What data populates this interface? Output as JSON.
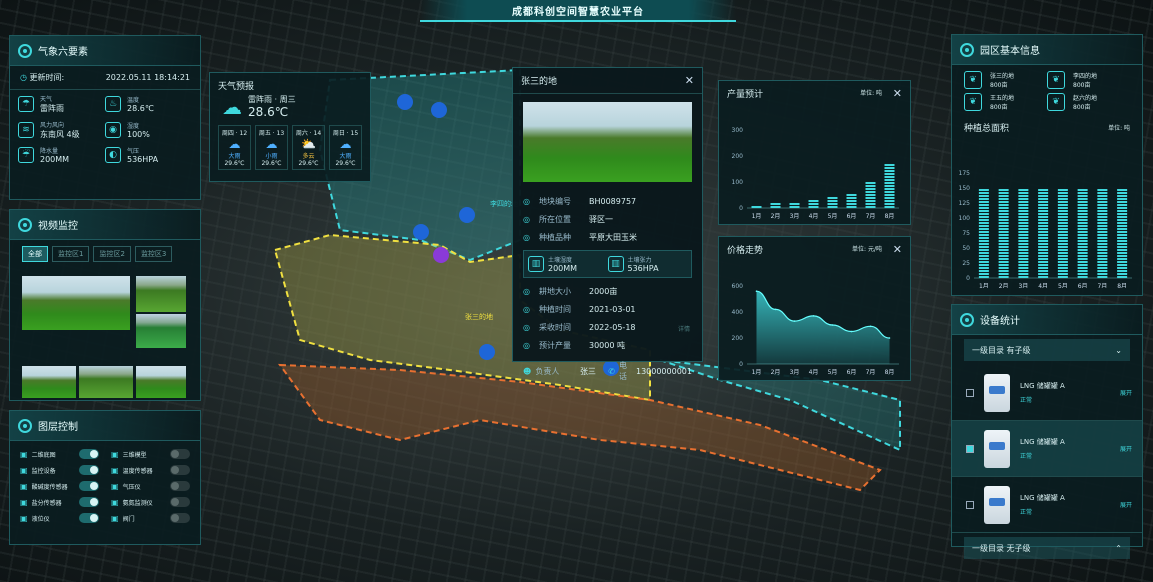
{
  "header": {
    "title": "成都科创空间智慧农业平台"
  },
  "weather": {
    "title": "气象六要素",
    "update_label": "更新时间:",
    "update_time": "2022.05.11 18:14:21",
    "items": [
      {
        "icon": "cloud-rain-icon",
        "label": "天气",
        "value": "雷阵雨"
      },
      {
        "icon": "thermometer-icon",
        "label": "温度",
        "value": "28.6℃"
      },
      {
        "icon": "wind-icon",
        "label": "风力风向",
        "value": "东南风 4级"
      },
      {
        "icon": "droplet-icon",
        "label": "湿度",
        "value": "100%"
      },
      {
        "icon": "rain-gauge-icon",
        "label": "降水量",
        "value": "200MM"
      },
      {
        "icon": "pressure-icon",
        "label": "气压",
        "value": "536HPA"
      }
    ]
  },
  "forecast": {
    "title": "天气预报",
    "now_desc": "雷阵雨 · 周三",
    "now_temp": "28.6℃",
    "days": [
      {
        "day": "周四 · 12",
        "desc": "大雨",
        "temp": "29.6℃",
        "color": "#4fb0ff"
      },
      {
        "day": "周五 · 13",
        "desc": "小雨",
        "temp": "29.6℃",
        "color": "#4fb0ff"
      },
      {
        "day": "周六 · 14",
        "desc": "多云",
        "temp": "29.6℃",
        "color": "#f0c040"
      },
      {
        "day": "周日 · 15",
        "desc": "大雨",
        "temp": "29.6℃",
        "color": "#4fb0ff"
      }
    ]
  },
  "video": {
    "title": "视频监控",
    "tabs": [
      "全部",
      "监控区1",
      "监控区2",
      "监控区3"
    ]
  },
  "layers": {
    "title": "图层控制",
    "items": [
      {
        "label": "二维底图",
        "on": true
      },
      {
        "label": "三维模型",
        "on": false
      },
      {
        "label": "监控设备",
        "on": true
      },
      {
        "label": "温度传感器",
        "on": false
      },
      {
        "label": "酸碱度传感器",
        "on": true
      },
      {
        "label": "气压仪",
        "on": false
      },
      {
        "label": "盐分传感器",
        "on": true
      },
      {
        "label": "氨氮监测仪",
        "on": false
      },
      {
        "label": "液位仪",
        "on": true
      },
      {
        "label": "阀门",
        "on": false
      }
    ]
  },
  "plot": {
    "title": "张三的地",
    "fields": [
      {
        "icon": "id-icon",
        "label": "地块编号",
        "value": "BH0089757"
      },
      {
        "icon": "location-pin-icon",
        "label": "所在位置",
        "value": "驿区一"
      },
      {
        "icon": "sprout-icon",
        "label": "种植品种",
        "value": "平原大田玉米"
      }
    ],
    "soil": [
      {
        "label": "土壤湿度",
        "value": "200MM"
      },
      {
        "label": "土壤张力",
        "value": "536HPA"
      }
    ],
    "fields2": [
      {
        "icon": "area-icon",
        "label": "耕地大小",
        "value": "2000亩"
      },
      {
        "icon": "clock-icon",
        "label": "种植时间",
        "value": "2021-03-01"
      },
      {
        "icon": "harvest-icon",
        "label": "采收时间",
        "value": "2022-05-18"
      },
      {
        "icon": "chart-icon",
        "label": "预计产量",
        "value": "30000 吨"
      }
    ],
    "detail_link": "详情",
    "owner_label": "负责人",
    "owner": "张三",
    "phone_label": "电话",
    "phone": "13000000001"
  },
  "map_labels": {
    "plot_a": "张三的地",
    "plot_b": "李四的地"
  },
  "yield": {
    "title": "产量预计",
    "unit": "单位: 吨"
  },
  "price": {
    "title": "价格走势",
    "unit": "单位: 元/吨"
  },
  "park": {
    "title": "园区基本信息",
    "items": [
      {
        "name": "张三的地",
        "area": "800亩"
      },
      {
        "name": "李四的地",
        "area": "800亩"
      },
      {
        "name": "王五的地",
        "area": "800亩"
      },
      {
        "name": "赵六的地",
        "area": "800亩"
      }
    ],
    "area_title": "种植总面积",
    "area_unit": "单位: 吨"
  },
  "devices": {
    "title": "设备统计",
    "group_top": "一级目录 有子级",
    "group_bottom": "一级目录 无子级",
    "items": [
      {
        "name": "LNG 储罐罐 A",
        "status": "正常",
        "action": "展开",
        "checked": false
      },
      {
        "name": "LNG 储罐罐 A",
        "status": "正常",
        "action": "展开",
        "checked": true
      },
      {
        "name": "LNG 储罐罐 A",
        "status": "正常",
        "action": "展开",
        "checked": false
      }
    ]
  },
  "chart_data": [
    {
      "type": "bar",
      "title": "产量预计",
      "unit": "单位: 吨",
      "categories": [
        "1月",
        "2月",
        "3月",
        "4月",
        "5月",
        "6月",
        "7月",
        "8月"
      ],
      "values": [
        5,
        12,
        18,
        25,
        35,
        50,
        100,
        170
      ],
      "ylim": [
        0,
        300
      ],
      "yticks": [
        0,
        100,
        200,
        300
      ]
    },
    {
      "type": "area",
      "title": "价格走势",
      "unit": "单位: 元/吨",
      "categories": [
        "1月",
        "2月",
        "3月",
        "4月",
        "5月",
        "6月",
        "7月",
        "8月"
      ],
      "values": [
        560,
        420,
        330,
        370,
        300,
        250,
        290,
        200
      ],
      "ylim": [
        0,
        600
      ],
      "yticks": [
        0,
        200,
        400,
        600
      ]
    },
    {
      "type": "bar",
      "title": "种植总面积",
      "unit": "单位: 吨",
      "categories": [
        "1月",
        "2月",
        "3月",
        "4月",
        "5月",
        "6月",
        "7月",
        "8月"
      ],
      "values": [
        148,
        148,
        148,
        148,
        148,
        148,
        148,
        148
      ],
      "ylim": [
        0,
        175
      ],
      "yticks": [
        0,
        25,
        50,
        75,
        100,
        125,
        150,
        175
      ]
    }
  ]
}
